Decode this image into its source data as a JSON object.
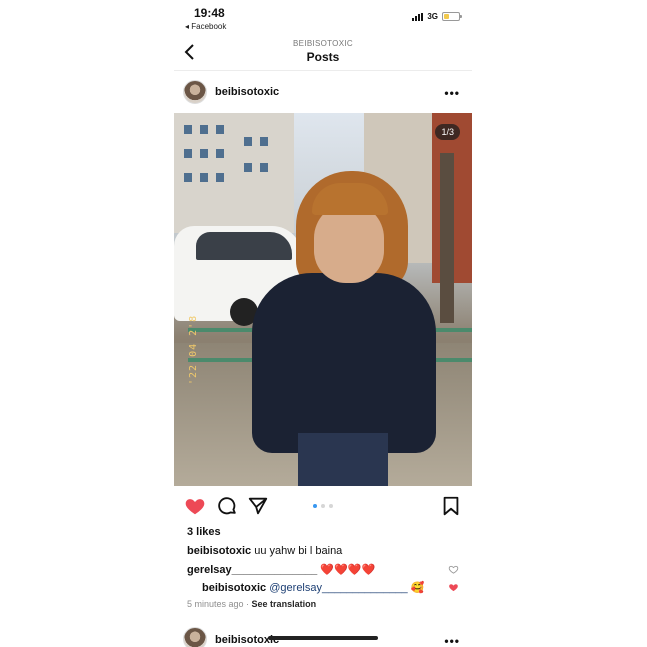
{
  "status_bar": {
    "time": "19:48",
    "back_app": "◂ Facebook",
    "network": "3G",
    "battery_level": 0.3,
    "battery_color": "#f2c94c"
  },
  "header": {
    "username": "BEIBISOTOXIC",
    "title": "Posts",
    "back_icon": "chevron-left-icon"
  },
  "post": {
    "username": "beibisotoxic",
    "more_label": "•••",
    "counter": "1/3",
    "date_stamp": "'22 04 2'8",
    "carousel": {
      "count": 3,
      "active_index": 0,
      "active_color": "#3897f0"
    },
    "liked": true,
    "like_color": "#ed4956",
    "likes": "3 likes",
    "caption": {
      "user": "beibisotoxic",
      "text": " uu yahw bi l baina"
    },
    "comment": {
      "user": "gerelsay______________",
      "text": " ❤️❤️❤️❤️"
    },
    "reply": {
      "user": "beibisotoxic",
      "mention": "@gerelsay______________",
      "text": " 🥰"
    },
    "time_ago": "5 minutes ago",
    "separator": " · ",
    "see_translation": "See translation"
  },
  "next_post": {
    "username": "beibisotoxic",
    "more_label": "•••"
  }
}
